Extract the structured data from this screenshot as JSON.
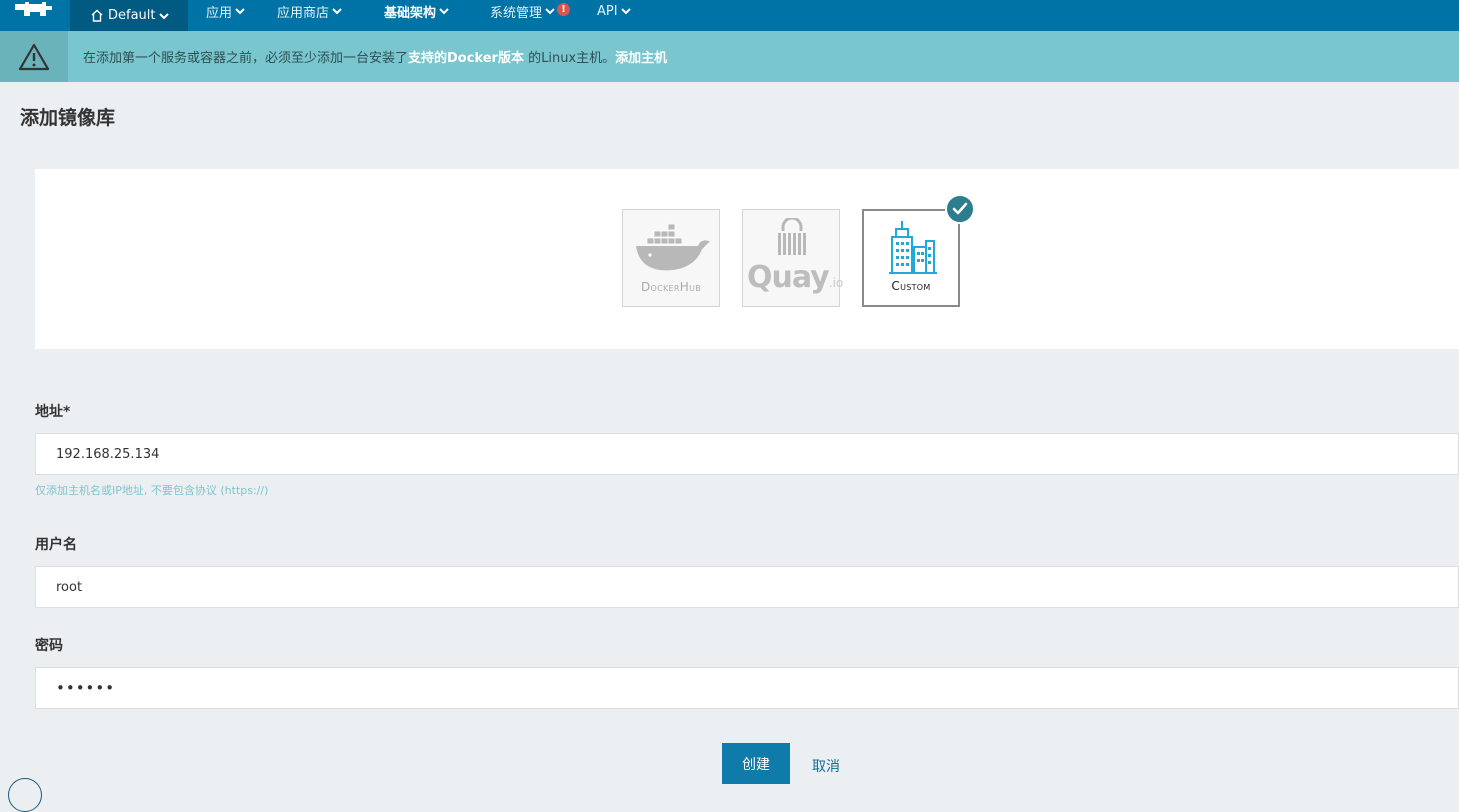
{
  "nav": {
    "environment": "Default",
    "items": [
      "应用",
      "应用商店",
      "基础架构",
      "系统管理",
      "API"
    ],
    "active_item": "基础架构",
    "alert_badge": "!"
  },
  "banner": {
    "text_before": "在添加第一个服务或容器之前，必须至少添加一台安装了",
    "link_supported": "支持的Docker版本",
    "text_middle": " 的Linux主机。",
    "link_add_host": "添加主机"
  },
  "page_title": "添加镜像库",
  "registry_options": [
    {
      "id": "dockerhub",
      "label": "DockerHub",
      "selected": false
    },
    {
      "id": "quay",
      "label": "Quay.io",
      "selected": false
    },
    {
      "id": "custom",
      "label": "Custom",
      "selected": true
    }
  ],
  "quay_logo": {
    "main": "Quay",
    "suffix": ".io"
  },
  "form": {
    "address_label": "地址*",
    "address_value": "192.168.25.134",
    "address_help": "仅添加主机名或IP地址, 不要包含协议 (https://)",
    "username_label": "用户名",
    "username_value": "root",
    "password_label": "密码",
    "password_value": "••••••"
  },
  "buttons": {
    "create": "创建",
    "cancel": "取消"
  },
  "colors": {
    "nav_bg": "#0073a6",
    "banner_bg": "#79c6cf",
    "primary": "#0e7bab",
    "check": "#2c7d8e",
    "custom_icon": "#1fa8d8"
  }
}
